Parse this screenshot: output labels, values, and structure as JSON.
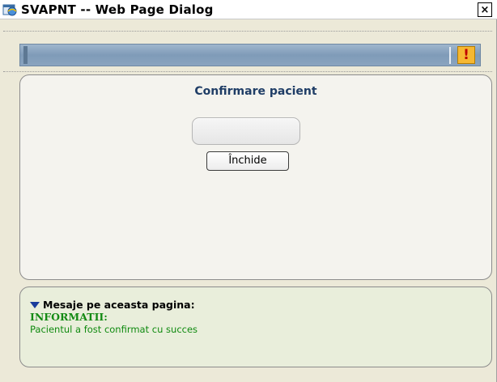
{
  "window": {
    "title": "SVAPNT -- Web Page Dialog",
    "close_glyph": "×",
    "icon": "ie-globe-icon"
  },
  "header": {
    "alert_glyph": "!",
    "alert_icon": "exclamation-icon"
  },
  "main": {
    "title": "Confirmare pacient",
    "display_value": "",
    "close_button_label": "Închide"
  },
  "messages": {
    "heading": "Mesaje pe aceasta pagina:",
    "toggle_icon": "triangle-down-icon",
    "category": "INFORMATII:",
    "text": "Pacientul a fost confirmat cu succes"
  },
  "colors": {
    "panel_title": "#1f3d66",
    "header_strip": "#8aa4bf",
    "alert_bg": "#f6b832",
    "info_green": "#138a13",
    "messages_bg": "#e9eedb"
  }
}
